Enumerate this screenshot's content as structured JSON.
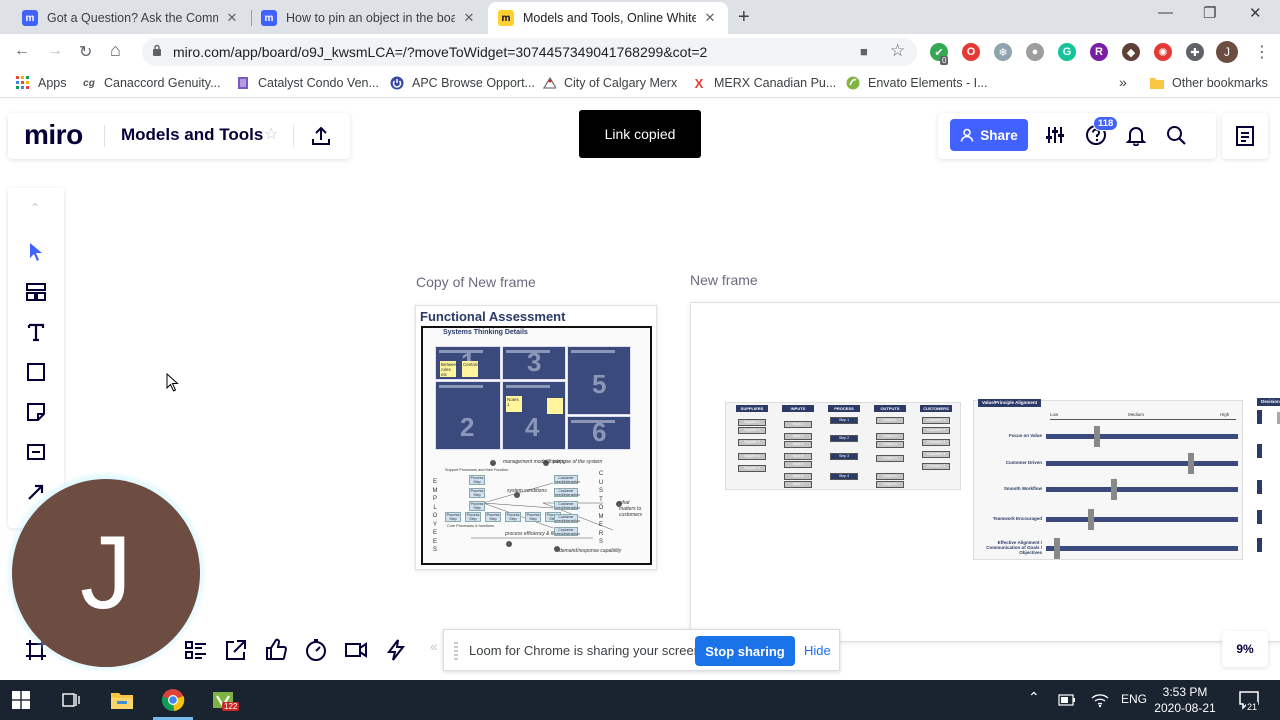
{
  "browser": {
    "tabs": [
      {
        "title": "Got a Question? Ask the Commu",
        "icon": "miro-favicon",
        "active": false
      },
      {
        "title": "How to pin an object in the boar",
        "icon": "miro-favicon",
        "active": false
      },
      {
        "title": "Models and Tools, Online Whitel",
        "icon": "miro-favicon-yellow",
        "active": true
      }
    ],
    "favicon_glyph": "m",
    "close_glyph": "✕",
    "new_tab_glyph": "+",
    "window_controls": {
      "minimize": "—",
      "restore": "❐",
      "close": "✕"
    },
    "nav": {
      "back": "←",
      "forward": "→",
      "reload": "↻",
      "home": "⌂"
    },
    "url": "miro.com/app/board/o9J_kwsmLCA=/?moveToWidget=3074457349041768299&cot=2",
    "omnibox_icons": {
      "camera": "■",
      "bookmark": "☆"
    },
    "extensions": [
      {
        "name": "shield-extension-icon",
        "glyph": "✔",
        "color": "#34a853"
      },
      {
        "name": "opera-extension-icon",
        "glyph": "O",
        "color": "#e53935"
      },
      {
        "name": "snowflake-extension-icon",
        "glyph": "❄",
        "color": "#90a4ae"
      },
      {
        "name": "circle-extension-icon",
        "glyph": "●",
        "color": "#9e9e9e"
      },
      {
        "name": "grammarly-extension-icon",
        "glyph": "G",
        "color": "#15c39a"
      },
      {
        "name": "r-extension-icon",
        "glyph": "R",
        "color": "#7b1fa2"
      },
      {
        "name": "toggl-extension-icon",
        "glyph": "◆",
        "color": "#5d4037"
      },
      {
        "name": "spiral-extension-icon",
        "glyph": "✺",
        "color": "#e53935"
      },
      {
        "name": "puzzle-extension-icon",
        "glyph": "✚",
        "color": "#5f6368"
      }
    ],
    "extension_badge": "0",
    "profile_initial": "J",
    "menu_glyph": "⋮",
    "bookmarks": [
      {
        "label": "Apps",
        "icon": "apps-grid-icon"
      },
      {
        "label": "Canaccord Genuity...",
        "icon": "cg-icon"
      },
      {
        "label": "Catalyst Condo Ven...",
        "icon": "catalyst-icon"
      },
      {
        "label": "APC Browse Opport...",
        "icon": "apc-icon"
      },
      {
        "label": "City of Calgary Merx",
        "icon": "calgary-icon"
      },
      {
        "label": "MERX Canadian Pu...",
        "icon": "merx-icon"
      },
      {
        "label": "Envato Elements - I...",
        "icon": "envato-icon"
      }
    ],
    "bookmark_icon_glyphs": {
      "cg": "cg",
      "merx": "X"
    },
    "more_bookmarks": "»",
    "other_bookmarks": "Other bookmarks"
  },
  "miro": {
    "logo": "miro",
    "board_title": "Models and Tools",
    "star_glyph": "☆",
    "toast": "Link copied",
    "share_label": "Share",
    "help_badge": "118",
    "zoom": "9%",
    "toolbar_collapse": "⌃",
    "bottom_collapse": "«",
    "avatar_initial": "J",
    "frames": [
      {
        "label": "Copy of New frame"
      },
      {
        "label": "New frame"
      }
    ],
    "functional_assessment": {
      "title": "Functional Assessment",
      "subtitle": "Systems Thinking Details",
      "cell_numbers": [
        "1",
        "3",
        "5",
        "2",
        "4",
        "6"
      ],
      "stickies": [
        "Between roles etc",
        "Central",
        "Notes 1"
      ],
      "diagram_labels": [
        "management model/thinking",
        "purpose of the system",
        "system conditions",
        "what matters to customers",
        "process efficiency & flexibility",
        "demand/response capability"
      ],
      "employees_letters": [
        "E",
        "M",
        "P",
        "L",
        "O",
        "Y",
        "E",
        "E",
        "S"
      ],
      "customers_letters": [
        "C",
        "U",
        "S",
        "T",
        "O",
        "M",
        "E",
        "R",
        "S"
      ],
      "process_step": "Process Step",
      "customer_need": "Customer need/interaction",
      "support_process": "Support Processes and their Function",
      "core_process": "Core Processes & functions",
      "number_markers": [
        "1",
        "2",
        "3",
        "4",
        "5",
        "6"
      ]
    },
    "sipoc": {
      "columns": [
        "SUPPLIERS",
        "INPUTS",
        "PROCESS",
        "OUTPUTS",
        "CUSTOMERS"
      ],
      "supplier_items": [
        "Supplier 1",
        "Supplier 2",
        "Supplier 3",
        "Supplier 4",
        "Supplier 5"
      ],
      "input_items": [
        "Input 1",
        "Input 2",
        "Input 3",
        "Input 4",
        "Input 5",
        "Input 6",
        "Input 7"
      ],
      "process_items": [
        "Step 1",
        "Step 2",
        "Step 3",
        "Step 4"
      ],
      "output_items": [
        "Output 1",
        "Output 2",
        "Output 3",
        "Output 4",
        "Output 5",
        "Output 6"
      ],
      "customer_items": [
        "Customer 1",
        "Customer 2",
        "Customer 3",
        "Customer 4",
        "Customer 5"
      ]
    },
    "value_alignment": {
      "title": "Value/Principle Alignment",
      "scale": [
        "Low",
        "Medium",
        "High"
      ],
      "rows": [
        {
          "label": "Focus on Value",
          "level": 0.25
        },
        {
          "label": "Customer Driven",
          "level": 0.74
        },
        {
          "label": "Smooth Workflow",
          "level": 0.34
        },
        {
          "label": "Teamwork Encouraged",
          "level": 0.22
        },
        {
          "label": "Effective Alignment / Communication of Goals / Objectives",
          "level": 0.04
        }
      ],
      "next_panel_title": "Decision"
    },
    "loom": {
      "message": "Loom for Chrome is sharing your screen.",
      "stop_label": "Stop sharing",
      "hide_label": "Hide"
    }
  },
  "taskbar": {
    "input_lang": "ENG",
    "time": "3:53 PM",
    "date": "2020-08-21",
    "notification_count": "21",
    "app_badge": "122",
    "tray_up": "⌃"
  }
}
